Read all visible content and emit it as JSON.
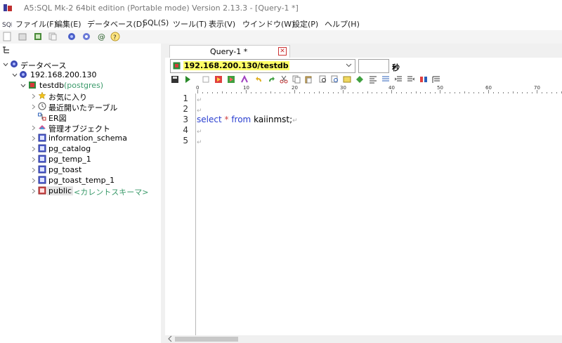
{
  "window": {
    "title": "A5:SQL Mk-2 64bit edition (Portable mode) Version 2.13.3 - [Query-1 *]"
  },
  "menu": {
    "items": [
      "ファイル(F)",
      "編集(E)",
      "データベース(D)",
      "SQL(S)",
      "ツール(T)",
      "表示(V)",
      "ウインドウ(W)",
      "設定(P)",
      "ヘルプ(H)"
    ]
  },
  "tree": {
    "root": "データベース",
    "server": "192.168.200.130",
    "database": "testdb",
    "database_sub": "(postgres)",
    "items": [
      {
        "label": "お気に入り"
      },
      {
        "label": "最近開いたテーブル"
      },
      {
        "label": "ER図"
      },
      {
        "label": "管理オブジェクト"
      },
      {
        "label": "information_schema"
      },
      {
        "label": "pg_catalog"
      },
      {
        "label": "pg_temp_1"
      },
      {
        "label": "pg_toast"
      },
      {
        "label": "pg_toast_temp_1"
      },
      {
        "label": "public"
      }
    ],
    "current_schema_tag": "<カレントスキーマ>"
  },
  "tab": {
    "label": "Query-1 *",
    "close_glyph": "✕"
  },
  "connection": {
    "value": "192.168.200.130/testdb",
    "seconds_label": "秒"
  },
  "ruler": {
    "labels": [
      "0",
      "10",
      "20",
      "30",
      "40",
      "50",
      "60",
      "70"
    ]
  },
  "editor": {
    "line_numbers": [
      "1",
      "2",
      "3",
      "4",
      "5"
    ],
    "code": {
      "kw_select": "select",
      "star": "*",
      "kw_from": "from",
      "table": "kaiinmst;"
    },
    "eol_glyph": "↵"
  },
  "colors": {
    "keyword": "#2a3fd0",
    "operator": "#d04040",
    "connection_highlight": "#ffff66",
    "schema_tag": "#3a9a6a"
  }
}
